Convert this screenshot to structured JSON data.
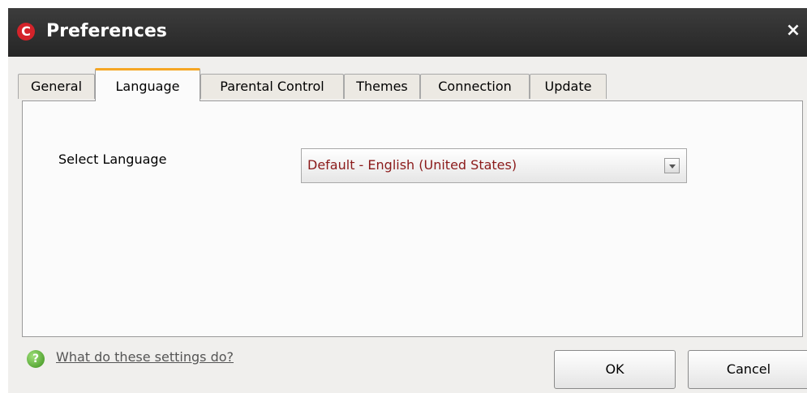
{
  "window": {
    "title": "Preferences",
    "logo_letter": "C",
    "close_glyph": "×"
  },
  "tabs": [
    {
      "label": "General",
      "active": false
    },
    {
      "label": "Language",
      "active": true
    },
    {
      "label": "Parental Control",
      "active": false
    },
    {
      "label": "Themes",
      "active": false
    },
    {
      "label": "Connection",
      "active": false
    },
    {
      "label": "Update",
      "active": false
    }
  ],
  "language_panel": {
    "select_label": "Select Language",
    "selected_language": "Default - English (United States)"
  },
  "footer": {
    "help_glyph": "?",
    "help_link": "What do these settings do?",
    "ok_label": "OK",
    "cancel_label": "Cancel"
  },
  "colors": {
    "titlebar": "#2f2f2f",
    "active_tab_accent": "#f5a623",
    "logo": "#d4232a",
    "select_text": "#8b1a1a",
    "help_icon": "#3a8f1a"
  },
  "icons": [
    "comodo-logo-icon",
    "close-icon",
    "dropdown-arrow-icon",
    "help-icon"
  ]
}
